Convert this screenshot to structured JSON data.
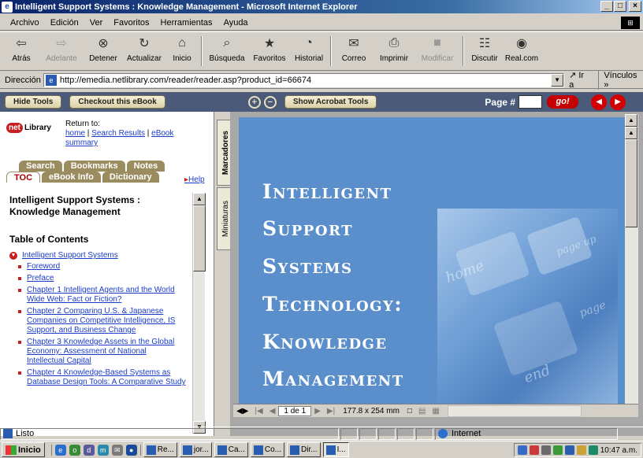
{
  "window": {
    "title": "Intelligent Support Systems : Knowledge Management - Microsoft Internet Explorer",
    "controls": [
      "_",
      "□",
      "×"
    ]
  },
  "menu": [
    {
      "label": "Archivo"
    },
    {
      "label": "Edición"
    },
    {
      "label": "Ver"
    },
    {
      "label": "Favoritos"
    },
    {
      "label": "Herramientas"
    },
    {
      "label": "Ayuda"
    }
  ],
  "toolbar": {
    "back": {
      "label": "Atrás",
      "icon": "⇦"
    },
    "forward": {
      "label": "Adelante",
      "icon": "⇨"
    },
    "stop": {
      "label": "Detener",
      "icon": "⊗"
    },
    "refresh": {
      "label": "Actualizar",
      "icon": "↻"
    },
    "home": {
      "label": "Inicio",
      "icon": "⌂"
    },
    "search": {
      "label": "Búsqueda",
      "icon": "⌕"
    },
    "favorites": {
      "label": "Favoritos",
      "icon": "★"
    },
    "history": {
      "label": "Historial",
      "icon": "◔"
    },
    "mail": {
      "label": "Correo",
      "icon": "✉"
    },
    "print": {
      "label": "Imprimir",
      "icon": "⎙"
    },
    "edit": {
      "label": "Modificar",
      "icon": "■"
    },
    "discuss": {
      "label": "Discutir",
      "icon": "☷"
    },
    "realcom": {
      "label": "Real.com",
      "icon": "◉"
    }
  },
  "address": {
    "label": "Dirección",
    "url": "http://emedia.netlibrary.com/reader/reader.asp?product_id=66674",
    "go_label": "Ir a",
    "links_label": "Vínculos"
  },
  "reader": {
    "hide_tools": "Hide Tools",
    "checkout": "Checkout this eBook",
    "show_acrobat": "Show Acrobat Tools",
    "page_label": "Page #",
    "page_value": "",
    "go_label": "go!"
  },
  "sidebar": {
    "logo_badge": "net",
    "logo_text": "Library",
    "return_to": "Return to:",
    "return_links": [
      "home",
      "Search Results",
      "eBook summary"
    ],
    "tabs_row1": [
      "Search",
      "Bookmarks",
      "Notes"
    ],
    "tabs_row2": [
      "TOC",
      "eBook Info",
      "Dictionary"
    ],
    "active_tab": "TOC",
    "help": "Help",
    "book_title": "Intelligent Support Systems : Knowledge Management",
    "toc_header": "Table of Contents",
    "toc_root": "Intelligent Support Systems",
    "toc_items": [
      "Foreword",
      "Preface",
      "Chapter 1 Intelligent Agents and the World Wide Web: Fact or Fiction?",
      "Chapter 2 Comparing U.S. & Japanese Companies on Competitive Intelligence, IS Support, and Business Change",
      "Chapter 3 Knowledge Assets in the Global Economy: Assessment of National Intellectual Capital",
      "Chapter 4 Knowledge-Based Systems as Database Design Tools: A Comparative Study"
    ]
  },
  "side_tabs": {
    "bookmarks": "Marcadores",
    "thumbnails": "Miniaturas"
  },
  "document": {
    "cover_lines": [
      "Intelligent",
      "Support",
      "Systems",
      "Technology:",
      "Knowledge",
      "Management"
    ],
    "photo_words": [
      "home",
      "page up",
      "end",
      "page"
    ],
    "page_counter": "1 de 1",
    "page_size": "177.8 x 254  mm"
  },
  "status": {
    "text": "Listo",
    "zone": "Internet"
  },
  "taskbar": {
    "start": "Inicio",
    "tasks": [
      "Re...",
      "jor...",
      "Ca...",
      "Co...",
      "Dir...",
      "I..."
    ],
    "active_task": "I...",
    "time": "10:47 a.m."
  },
  "colors": {
    "title_bar": "#0a246a",
    "reader_bar": "#4a5a78",
    "cover_blue": "#5b8fcc",
    "accent_red": "#c81e1e",
    "tab_gold": "#9a8c5e",
    "link_blue": "#1a3cc8"
  }
}
